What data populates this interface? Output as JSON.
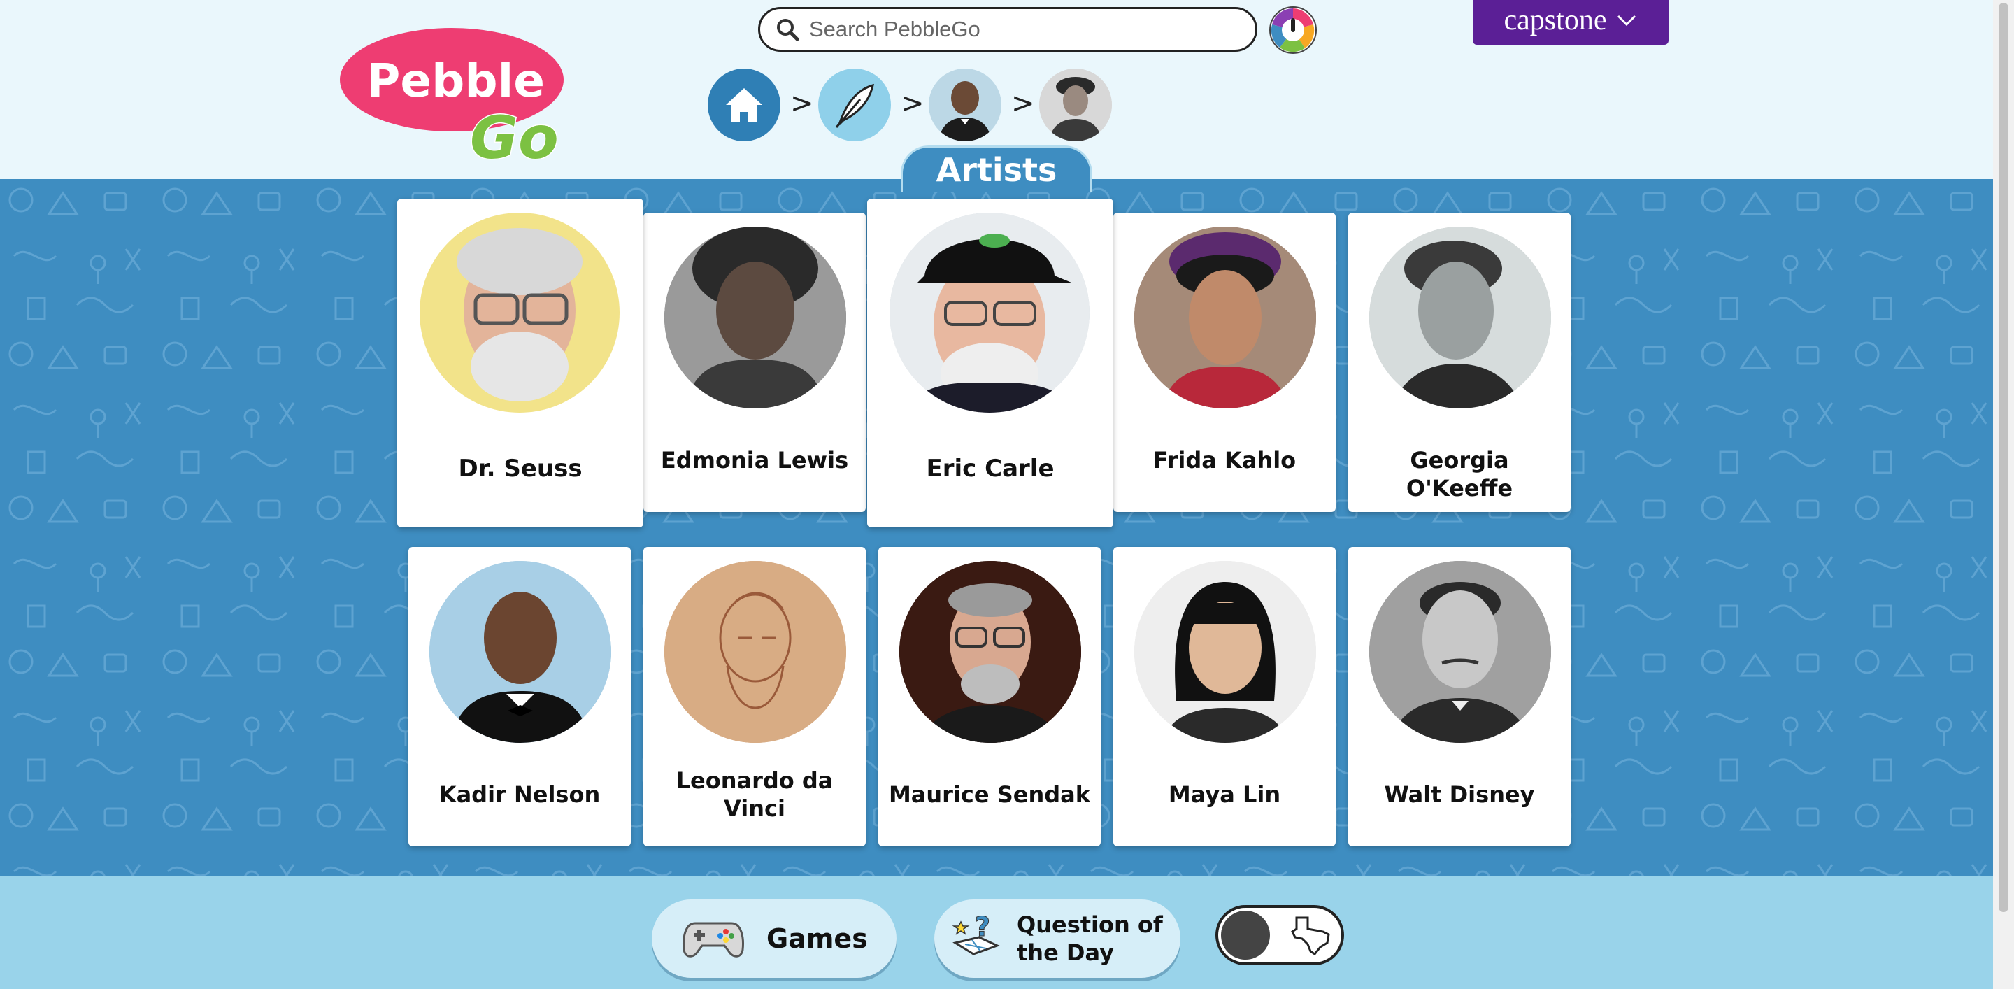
{
  "brand": {
    "logo_top": "Pebble",
    "logo_bottom": "Go",
    "publisher": "capstone"
  },
  "search": {
    "placeholder": "Search PebbleGo",
    "value": ""
  },
  "breadcrumb": [
    {
      "name": "home",
      "icon": "home-icon"
    },
    {
      "name": "artists-category",
      "icon": "feather-icon"
    },
    {
      "name": "person-portrait",
      "icon": "portrait"
    },
    {
      "name": "person-portrait",
      "icon": "portrait"
    }
  ],
  "breadcrumb_separator": ">",
  "section_title": "Artists",
  "cards": [
    {
      "name": "Dr. Seuss"
    },
    {
      "name": "Edmonia Lewis"
    },
    {
      "name": "Eric Carle"
    },
    {
      "name": "Frida Kahlo"
    },
    {
      "name": "Georgia O'Keeffe"
    },
    {
      "name": "Kadir Nelson"
    },
    {
      "name_line1": "Leonardo da",
      "name_line2": "Vinci"
    },
    {
      "name": "Maurice Sendak"
    },
    {
      "name": "Maya Lin"
    },
    {
      "name": "Walt Disney"
    }
  ],
  "footer": {
    "games_label": "Games",
    "qotd_line1": "Question of",
    "qotd_line2": "the Day"
  },
  "colors": {
    "main_bg": "#3e8dc1",
    "header_bg": "#eaf7fc",
    "footer_bg": "#99d3ea",
    "capstone_purple": "#5b1f96",
    "logo_pink": "#ee3d72",
    "logo_green": "#7cc142"
  }
}
